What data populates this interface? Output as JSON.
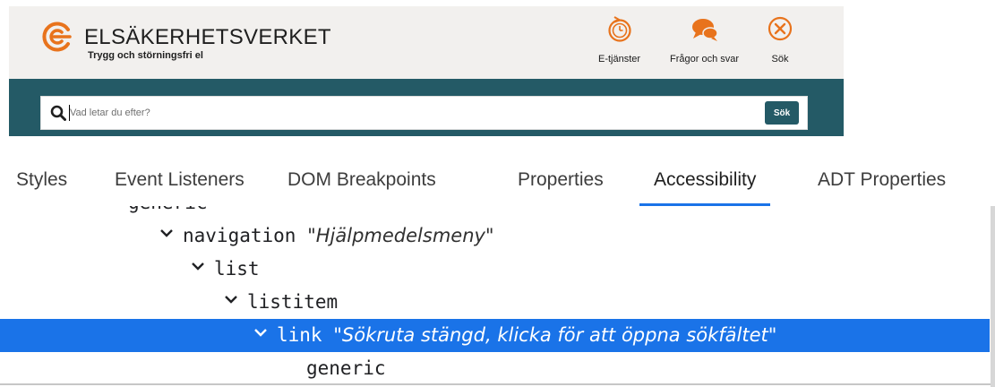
{
  "site": {
    "brand_name": "ELSÄKERHETSVERKET",
    "tagline": "Trygg och störningsfri el",
    "colors": {
      "accent": "#e8731c",
      "band": "#245a66",
      "header_bg": "#f2f0ee"
    },
    "header_links": [
      {
        "label": "E-tjänster",
        "icon": "timer-icon"
      },
      {
        "label": "Frågor och svar",
        "icon": "chat-bubbles-icon"
      },
      {
        "label": "Sök",
        "icon": "close-circle-icon"
      }
    ],
    "search": {
      "placeholder": "Vad letar du efter?",
      "value": "",
      "button_label": "Sök"
    }
  },
  "devtools": {
    "tabs": [
      {
        "label": "Styles",
        "active": false
      },
      {
        "label": "Event Listeners",
        "active": false
      },
      {
        "label": "DOM Breakpoints",
        "active": false
      },
      {
        "label": "Properties",
        "active": false
      },
      {
        "label": "Accessibility",
        "active": true
      },
      {
        "label": "ADT Properties",
        "active": false
      }
    ],
    "tree": [
      {
        "role": "generic",
        "name": "",
        "expanded": false,
        "selected": false
      },
      {
        "role": "navigation",
        "name": "\"Hjälpmedelsmeny\"",
        "expanded": true,
        "selected": false
      },
      {
        "role": "list",
        "name": "",
        "expanded": true,
        "selected": false
      },
      {
        "role": "listitem",
        "name": "",
        "expanded": true,
        "selected": false
      },
      {
        "role": "link",
        "name": "\"Sökruta stängd, klicka för att öppna sökfältet\"",
        "expanded": true,
        "selected": true
      },
      {
        "role": "generic",
        "name": "",
        "expanded": false,
        "selected": false
      }
    ],
    "colors": {
      "selection": "#1a73e8",
      "active_tab_underline": "#1a73e8"
    }
  }
}
